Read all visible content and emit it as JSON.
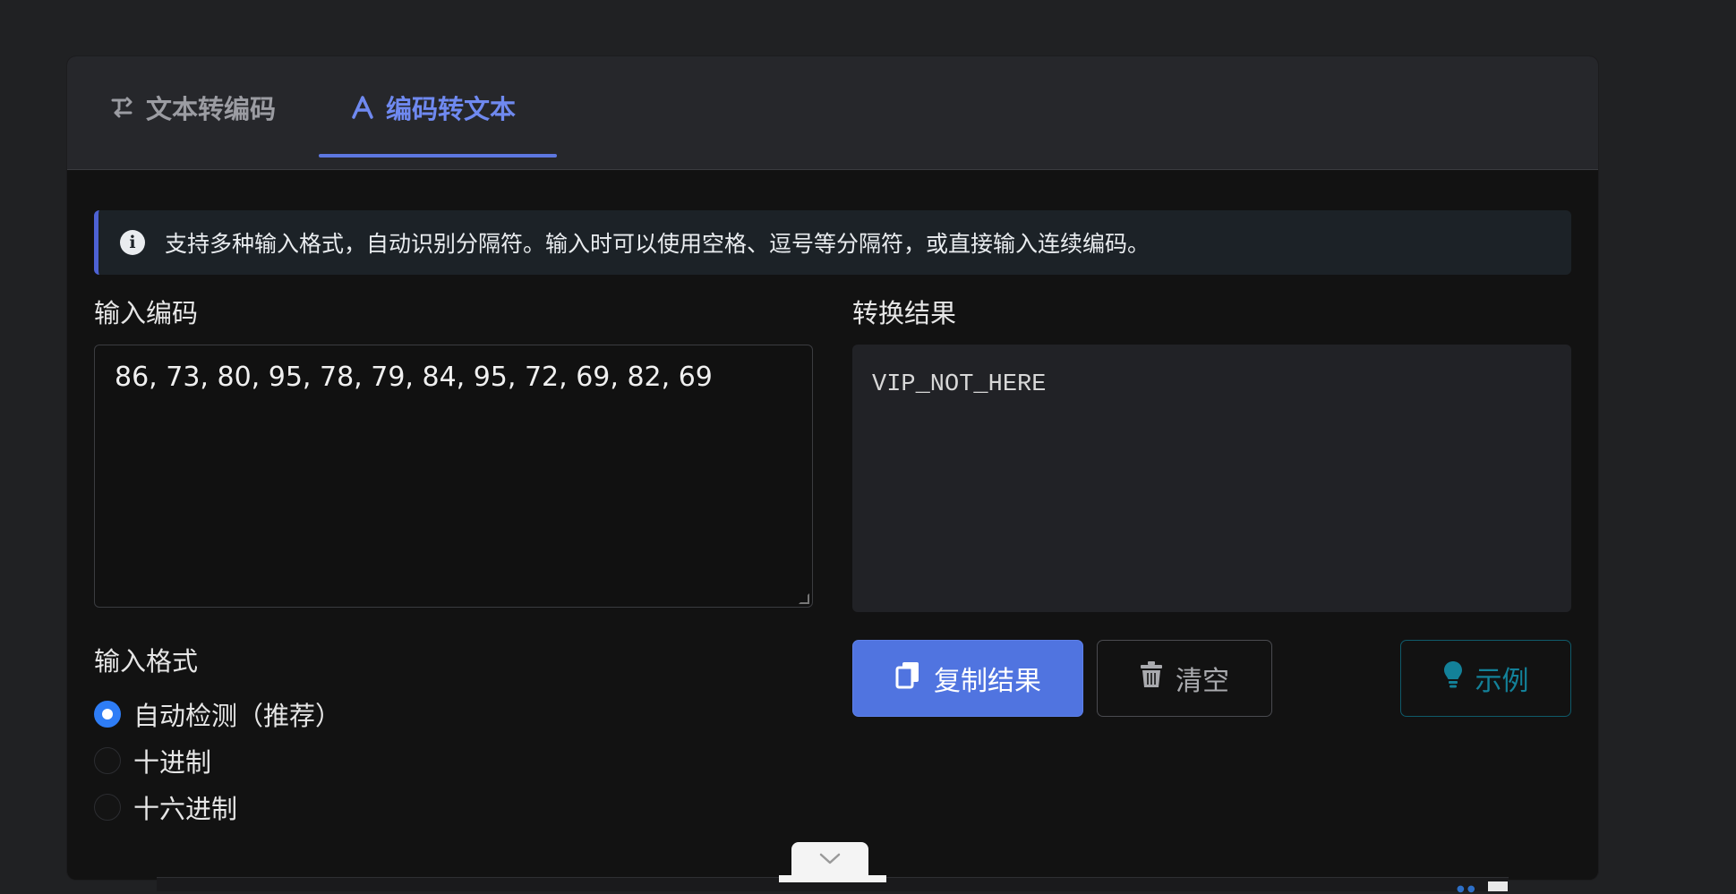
{
  "tabs": [
    {
      "label": "文本转编码",
      "icon": "text-to-code-icon",
      "active": false
    },
    {
      "label": "编码转文本",
      "icon": "font-a-icon",
      "active": true
    }
  ],
  "info": {
    "icon": "info-icon",
    "icon_glyph": "i",
    "text": "支持多种输入格式，自动识别分隔符。输入时可以使用空格、逗号等分隔符，或直接输入连续编码。"
  },
  "input_section": {
    "label": "输入编码",
    "value": "86, 73, 80, 95, 78, 79, 84, 95, 72, 69, 82, 69"
  },
  "result_section": {
    "label": "转换结果",
    "value": "VIP_NOT_HERE"
  },
  "format_section": {
    "label": "输入格式",
    "options": [
      {
        "label": "自动检测（推荐）",
        "checked": true
      },
      {
        "label": "十进制",
        "checked": false
      },
      {
        "label": "十六进制",
        "checked": false
      }
    ]
  },
  "buttons": {
    "copy": {
      "label": "复制结果",
      "icon": "copy-icon"
    },
    "clear": {
      "label": "清空",
      "icon": "trash-icon"
    },
    "example": {
      "label": "示例",
      "icon": "lightbulb-icon"
    }
  },
  "colors": {
    "accent": "#5074e0",
    "active_tab": "#6f89f0",
    "info_border": "#4d62d4",
    "example": "#138199",
    "radio_checked": "#2e7df6"
  }
}
